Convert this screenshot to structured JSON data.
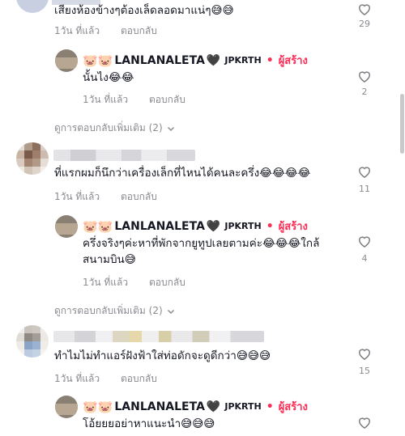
{
  "comments": [
    {
      "text": "เสียงห้องข้างๆต้องเล็ดลอดมาแน่ๆ😅😅",
      "time": "1วัน ที่แล้ว",
      "reply_label": "ตอบกลับ",
      "likes": "29"
    },
    {
      "text": "นั้นไง😂😂",
      "time": "1วัน ที่แล้ว",
      "reply_label": "ตอบกลับ",
      "likes": "2"
    },
    {
      "text": "ที่แรกผมก็นึกว่าเครื่องเล็กที่ไหนได้คนละครึ่ง😂😂😂😂",
      "time": "1วัน ที่แล้ว",
      "reply_label": "ตอบกลับ",
      "likes": "11"
    },
    {
      "text_line1": "ครึ่งจริงๆค่ะหาที่พักจากยูทูปเลยตามค่ะ😂😂😂ใกล้",
      "text_line2": "สนามบิน😅",
      "time": "1วัน ที่แล้ว",
      "reply_label": "ตอบกลับ",
      "likes": "4"
    },
    {
      "text": "ทำไมไม่ทำแอร์ฝังฟ้าใส่ท่อดักจะดูดีกว่า😅😅😅",
      "time": "1วัน ที่แล้ว",
      "reply_label": "ตอบกลับ",
      "likes": "15"
    },
    {
      "text": "โอ้ยยยอย่าหาแนะนำ😅😅😅"
    }
  ],
  "creator": {
    "pigs": "🐷🐷",
    "name": "LANLANALETA",
    "heart": "🖤",
    "tag": "JPKRTH",
    "dot": "•",
    "badge": "ผู้สร้าง"
  },
  "more_replies": "ดูการตอบกลับเพิ่มเติม (2)",
  "colors": {
    "creator_accent": "#fe2c55",
    "meta_gray": "#8a8b91",
    "text": "#161823"
  }
}
